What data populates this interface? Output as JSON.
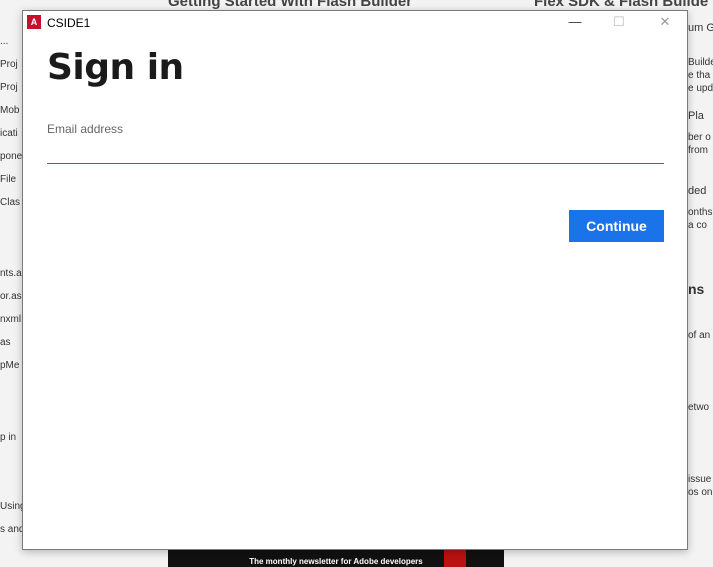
{
  "background": {
    "headings": [
      "Getting Started With Flash Builder",
      "Flex SDK & Flash Builde"
    ],
    "left_items": [
      "...",
      "Proj",
      "Proj",
      "Mob",
      "icati",
      "pone",
      "File",
      "Clas",
      "nts.a",
      "or.as",
      "nxml",
      "as",
      "pMe",
      "p in",
      "Using",
      "s and"
    ],
    "right_items": [
      "um G",
      "Builde",
      "e tha",
      "e upd",
      "Pla",
      "ber o",
      "from",
      "ded",
      "onths",
      "a co",
      "ns",
      "of an",
      "etwo",
      "issue",
      "os on"
    ],
    "banner_text": "The monthly newsletter for Adobe developers"
  },
  "dialog": {
    "app_icon": "adobe-icon",
    "app_icon_glyph": "A",
    "window_title": "CSIDE1",
    "minimize_glyph": "—",
    "maximize_glyph": "☐",
    "close_glyph": "✕",
    "heading": "Sign in",
    "email_label": "Email address",
    "email_value": "",
    "continue_label": "Continue"
  }
}
